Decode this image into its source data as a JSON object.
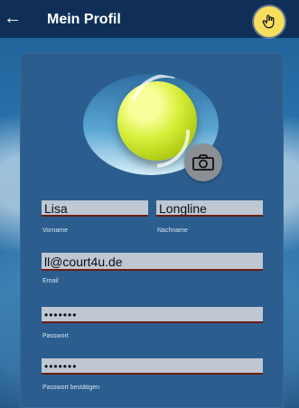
{
  "header": {
    "title": "Mein Profil"
  },
  "profile": {
    "first_name": {
      "value": "Lisa",
      "label": "Vorname"
    },
    "last_name": {
      "value": "Longline",
      "label": "Nachname"
    },
    "email": {
      "value": "ll@court4u.de",
      "label": "Email"
    },
    "password": {
      "value": "•••••••",
      "label": "Passwort"
    },
    "password_confirm": {
      "value": "•••••••",
      "label": "Passwort bestätigen"
    }
  },
  "icons": {
    "back": "back-arrow-icon",
    "camera": "camera-icon",
    "pointer": "hand-pointer-icon",
    "avatar": "tennis-ball-avatar"
  },
  "colors": {
    "header_bg": "#0f2f56",
    "card_bg": "#2b5d8e",
    "field_bg": "#bfc7d2",
    "field_underline": "#6b1d12",
    "cursor_highlight": "#f6df5e"
  }
}
